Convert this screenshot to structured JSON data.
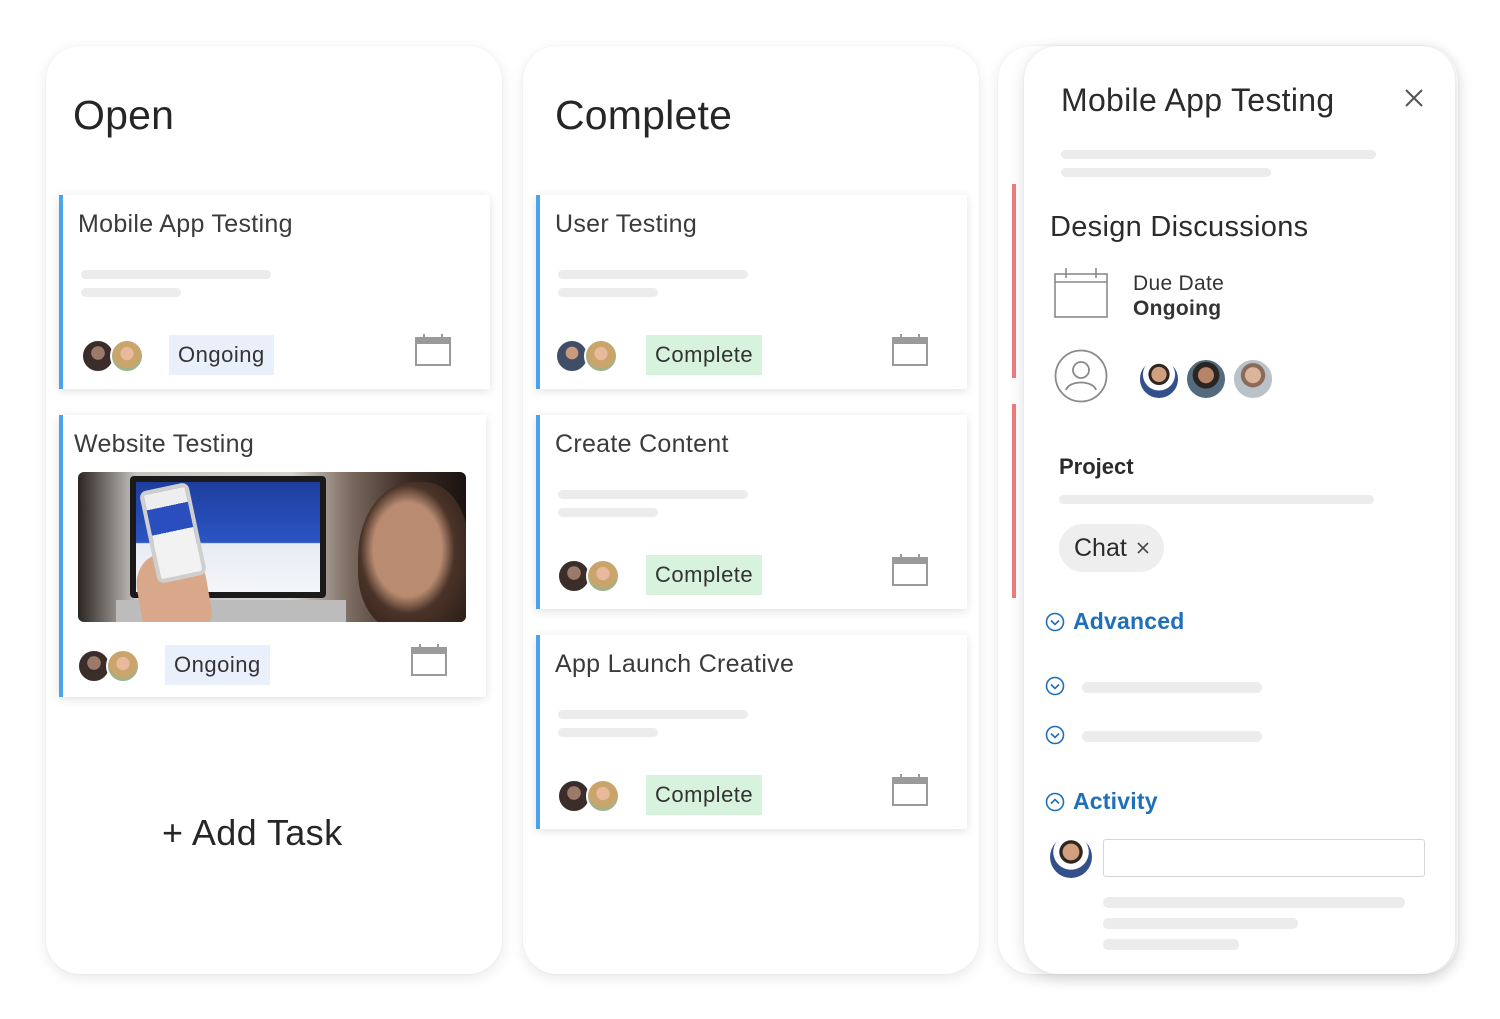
{
  "columns": {
    "open": {
      "title": "Open",
      "cards": [
        {
          "title": "Mobile App Testing",
          "status": "Ongoing"
        },
        {
          "title": "Website Testing",
          "status": "Ongoing"
        }
      ],
      "add_task_label": "+ Add Task"
    },
    "complete": {
      "title": "Complete",
      "cards": [
        {
          "title": "User Testing",
          "status": "Complete"
        },
        {
          "title": "Create Content",
          "status": "Complete"
        },
        {
          "title": "App Launch Creative",
          "status": "Complete"
        }
      ]
    }
  },
  "detail_panel": {
    "title": "Mobile App Testing",
    "section_title": "Design Discussions",
    "due_date_label": "Due Date",
    "due_date_value": "Ongoing",
    "project_label": "Project",
    "project_chip": "Chat",
    "advanced_label": "Advanced",
    "activity_label": "Activity",
    "comment_placeholder": ""
  },
  "colors": {
    "card_accent": "#4aa3ec",
    "ongoing_badge": "#eaf0fb",
    "complete_badge": "#d7f3dd",
    "link_blue": "#1f6fba",
    "red_accent": "#f07c7c"
  },
  "icons": {
    "calendar": "calendar-icon",
    "close": "close-icon",
    "user": "user-icon",
    "chevron": "chevron-circle-icon"
  }
}
